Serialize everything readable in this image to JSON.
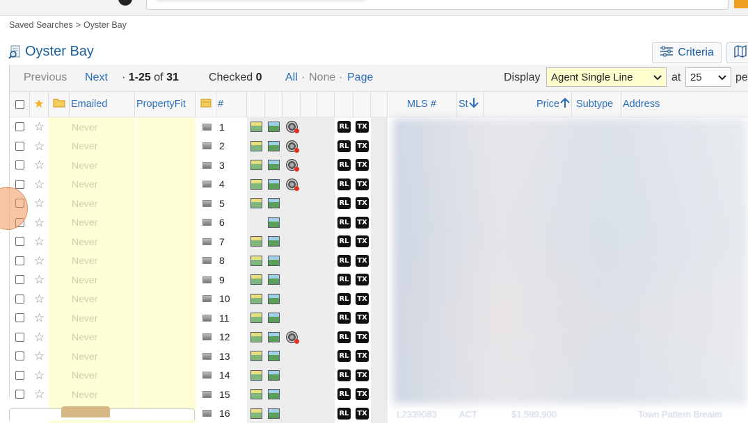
{
  "breadcrumb": {
    "root": "Saved Searches",
    "separator": ">",
    "current": "Oyster Bay"
  },
  "page": {
    "title": "Oyster Bay",
    "criteria_label": "Criteria"
  },
  "toolbar": {
    "previous": "Previous",
    "next": "Next",
    "range_prefix": "·",
    "range": "1-25",
    "range_of": "of",
    "total": "31",
    "checked_label": "Checked",
    "checked_count": "0",
    "all": "All",
    "none": "None",
    "page": "Page",
    "dot": "·",
    "display_label": "Display",
    "display_value": "Agent Single Line",
    "at_label": "at",
    "per_page_value": "25",
    "per_label": "pe"
  },
  "columns": {
    "emailed": "Emailed",
    "propertyfit": "PropertyFit",
    "number": "#",
    "mls": "MLS #",
    "status": "St",
    "price": "Price",
    "subtype": "Subtype",
    "address": "Address"
  },
  "badges": {
    "rl": "RL",
    "tx": "TX"
  },
  "rows": [
    {
      "num": "1",
      "emailed": "Never",
      "photo": true,
      "reel": true
    },
    {
      "num": "2",
      "emailed": "Never",
      "photo": true,
      "reel": true
    },
    {
      "num": "3",
      "emailed": "Never",
      "photo": true,
      "reel": true
    },
    {
      "num": "4",
      "emailed": "Never",
      "photo": true,
      "reel": true
    },
    {
      "num": "5",
      "emailed": "Never",
      "photo": true,
      "reel": false
    },
    {
      "num": "6",
      "emailed": "Never",
      "photo": false,
      "reel": false
    },
    {
      "num": "7",
      "emailed": "Never",
      "photo": true,
      "reel": false
    },
    {
      "num": "8",
      "emailed": "Never",
      "photo": true,
      "reel": false
    },
    {
      "num": "9",
      "emailed": "Never",
      "photo": true,
      "reel": false
    },
    {
      "num": "10",
      "emailed": "Never",
      "photo": true,
      "reel": false
    },
    {
      "num": "11",
      "emailed": "Never",
      "photo": true,
      "reel": false
    },
    {
      "num": "12",
      "emailed": "Never",
      "photo": true,
      "reel": true
    },
    {
      "num": "13",
      "emailed": "Never",
      "photo": true,
      "reel": false
    },
    {
      "num": "14",
      "emailed": "Never",
      "photo": true,
      "reel": false
    },
    {
      "num": "15",
      "emailed": "Never",
      "photo": true,
      "reel": false
    },
    {
      "num": "16",
      "emailed": "",
      "photo": true,
      "reel": false
    }
  ],
  "partial_row": {
    "mls": "L2339083",
    "status": "ACT",
    "price": "$1,599,900",
    "address": "Town Pattern Breaim"
  },
  "icons": {
    "star": "star-icon",
    "folder": "folder-icon",
    "camera": "camera-icon",
    "photo": "photo-icon",
    "reel": "film-reel-icon",
    "sort_down": "arrow-down-icon",
    "sort_up": "arrow-up-icon",
    "criteria": "sliders-icon",
    "map": "map-icon",
    "doc": "search-doc-icon"
  },
  "colors": {
    "link": "#2a6ebb",
    "title": "#1c5e9a",
    "highlight": "#ffffd6",
    "display_select": "#ffffd0"
  }
}
